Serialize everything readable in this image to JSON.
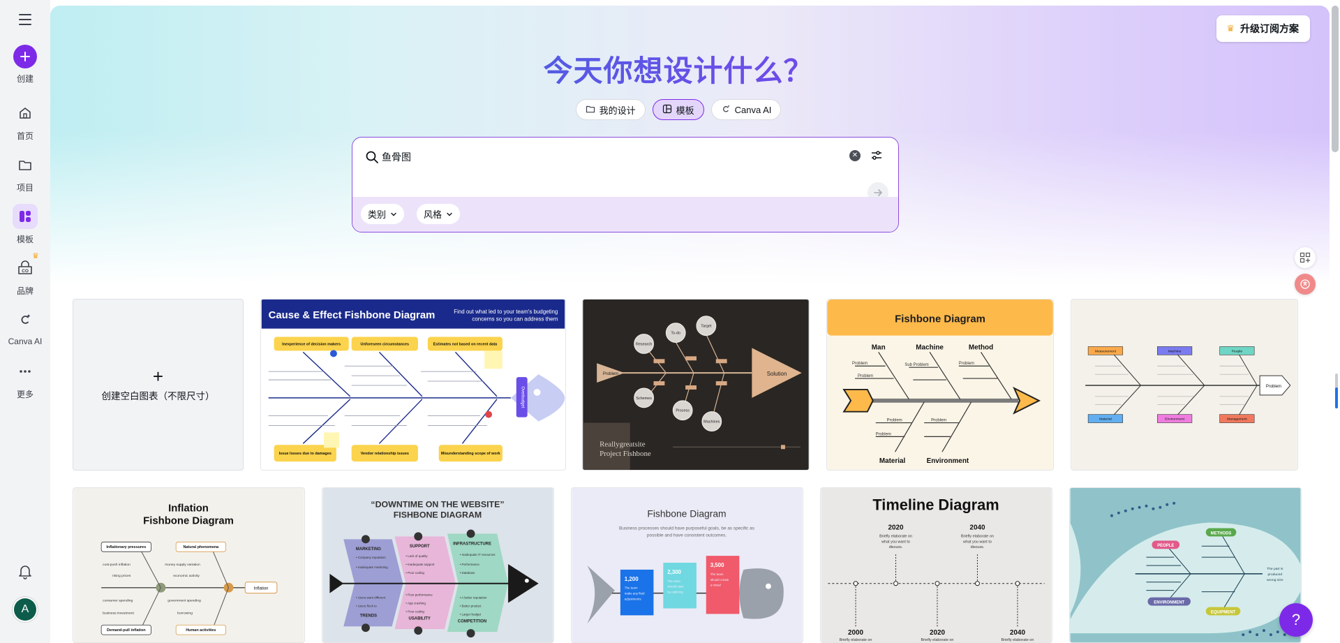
{
  "rail": {
    "create_label": "创建",
    "home_label": "首页",
    "projects_label": "项目",
    "templates_label": "模板",
    "brand_label": "品牌",
    "canva_ai_label": "Canva AI",
    "more_label": "更多",
    "avatar_initial": "A",
    "accent_color": "#7d2ae8"
  },
  "header": {
    "upgrade_label": "升级订阅方案",
    "title": "今天你想设计什么？"
  },
  "pills": [
    {
      "label": "我的设计",
      "icon": "folder-icon",
      "active": false
    },
    {
      "label": "模板",
      "icon": "template-icon",
      "active": true
    },
    {
      "label": "Canva AI",
      "icon": "canva-ai-icon",
      "active": false
    }
  ],
  "search": {
    "value": "鱼骨图",
    "chip_category": "类别",
    "chip_style": "风格"
  },
  "blank_card": {
    "label": "创建空白图表（不限尺寸）"
  },
  "templates": {
    "t1": {
      "title": "Cause & Effect Fishbone Diagram",
      "subtitle": "Find out what led to your team's budgeting concerns so you can address them",
      "boxes": [
        "Inexperience of decision makers",
        "Unforeseen circumstances",
        "Estimates not based on recent data",
        "Issue losses due to damages",
        "Vendor relationship issues",
        "Misunderstanding scope of work"
      ],
      "head": "Overbudget"
    },
    "t2": {
      "nodes": [
        "Research",
        "To-do",
        "Target",
        "Schemes",
        "Process",
        "Machines"
      ],
      "tail": "Problem",
      "head": "Solution",
      "footer": "Reallygreatsite Project Fishbone"
    },
    "t3": {
      "title": "Fishbone Diagram",
      "top_labels": [
        "Man",
        "Machine",
        "Method"
      ],
      "bottom_labels": [
        "Material",
        "Environment"
      ],
      "sub": [
        "Problem",
        "Problem",
        "Sub Problem",
        "Problem",
        "Problem",
        "Problem",
        "Problem"
      ]
    },
    "t4": {
      "boxes": [
        "Measurement",
        "Machine",
        "People",
        "Material",
        "Environment",
        "Management"
      ],
      "head": "Problem"
    },
    "t5": {
      "title": "Inflation Fishbone Diagram",
      "boxes": [
        "Inflationary pressures",
        "Natural phenomena",
        "Demand-pull inflation",
        "Human activities"
      ],
      "head": "Inflation"
    },
    "t6": {
      "title": "“DOWNTIME ON THE WEBSITE” FISHBONE DIAGRAM",
      "labels": [
        "MARKETING",
        "SUPPORT",
        "INFRASTRUCTURE",
        "TRENDS",
        "USABILITY",
        "COMPETITION"
      ]
    },
    "t7": {
      "title": "Fishbone Diagram",
      "subtitle": "Business processes should have purposeful goals, be as specific as possible and have consistent outcomes.",
      "values": [
        "1,200",
        "2,300",
        "3,500"
      ]
    },
    "t8": {
      "title": "Timeline Diagram",
      "years_top": [
        "2020",
        "2040"
      ],
      "years_bottom": [
        "2000",
        "2020",
        "2040"
      ],
      "caption": "Briefly elaborate on what you want to discuss."
    },
    "t9": {
      "labels": [
        "PEOPLE",
        "METHODS",
        "ENVIRONMENT",
        "EQUIPMENT"
      ],
      "head": "The part is produced wrong size"
    }
  },
  "help_label": "?"
}
